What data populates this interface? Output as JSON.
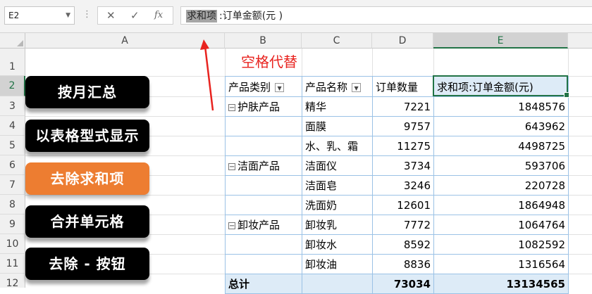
{
  "formula_bar": {
    "name_box": "E2",
    "cancel_icon": "✕",
    "enter_icon": "✓",
    "fx_icon": "fx",
    "selected_text": "求和项",
    "rest_text": ":订单金额(元 )"
  },
  "columns": [
    "A",
    "B",
    "C",
    "D",
    "E"
  ],
  "rows": [
    "1",
    "2",
    "3",
    "4",
    "5",
    "6",
    "7",
    "8",
    "9",
    "10",
    "11",
    "12"
  ],
  "selected_cell": {
    "column": "E",
    "row": "2"
  },
  "annotation": {
    "text": "空格代替",
    "color": "#e8231f"
  },
  "buttons": [
    {
      "label": "按月汇总",
      "color": "#000000"
    },
    {
      "label": "以表格型式显示",
      "color": "#000000"
    },
    {
      "label": "去除求和项",
      "color": "#ed7d31"
    },
    {
      "label": "合并单元格",
      "color": "#000000"
    },
    {
      "label": "去除 - 按钮",
      "color": "#000000"
    }
  ],
  "pivot": {
    "headers": [
      "产品类别",
      "产品名称",
      "订单数量",
      "求和项:订单金额(元)"
    ],
    "rows": [
      {
        "category": "护肤产品",
        "product": "精华",
        "qty": "7221",
        "amount": "1848576"
      },
      {
        "category": "",
        "product": "面膜",
        "qty": "9757",
        "amount": "643962"
      },
      {
        "category": "",
        "product": "水、乳、霜",
        "qty": "11275",
        "amount": "4498725"
      },
      {
        "category": "洁面产品",
        "product": "洁面仪",
        "qty": "3734",
        "amount": "593706"
      },
      {
        "category": "",
        "product": "洁面皂",
        "qty": "3246",
        "amount": "220728"
      },
      {
        "category": "",
        "product": "洗面奶",
        "qty": "12601",
        "amount": "1864948"
      },
      {
        "category": "卸妆产品",
        "product": "卸妆乳",
        "qty": "7772",
        "amount": "1064764"
      },
      {
        "category": "",
        "product": "卸妆水",
        "qty": "8592",
        "amount": "1082592"
      },
      {
        "category": "",
        "product": "卸妆油",
        "qty": "8836",
        "amount": "1316564"
      }
    ],
    "total": {
      "label": "总计",
      "qty": "73034",
      "amount": "13134565"
    },
    "header_fill": "#ddebf7",
    "border_color": "#9bc2e6"
  }
}
